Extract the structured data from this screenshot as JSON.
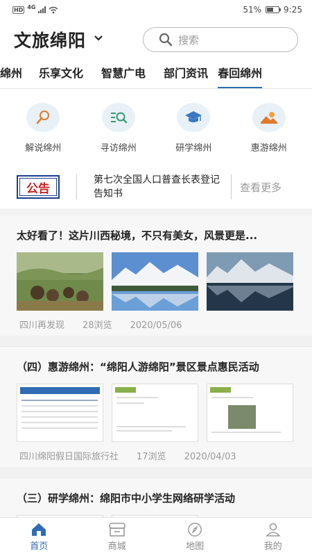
{
  "status_bar": {
    "network": "HD",
    "signal": "4G",
    "battery": "51%",
    "time": "9:25"
  },
  "header": {
    "title": "文旅绵阳",
    "search_placeholder": "搜索"
  },
  "tabs": [
    "绵州",
    "乐享文化",
    "智慧广电",
    "部门资讯",
    "春回绵州"
  ],
  "active_tab": "春回绵州",
  "quick_links": [
    {
      "label": "解说绵州",
      "icon": "microphone-icon"
    },
    {
      "label": "寻访绵州",
      "icon": "search-list-icon"
    },
    {
      "label": "研学绵州",
      "icon": "graduation-cap-icon"
    },
    {
      "label": "惠游绵州",
      "icon": "landscape-icon"
    }
  ],
  "notice": {
    "badge": "公告",
    "text": "第七次全国人口普查长表登记告知书",
    "more": "查看更多"
  },
  "articles": [
    {
      "title": "太好看了！这片川西秘境，不只有美女，风景更是...",
      "source": "四川再发现",
      "views": "28浏览",
      "date": "2020/05/06"
    },
    {
      "title": "（四）惠游绵州：“绵阳人游绵阳”景区景点惠民活动",
      "source": "四川绵阳假日国际旅行社",
      "views": "17浏览",
      "date": "2020/04/03"
    },
    {
      "title": "（三）研学绵州：绵阳市中小学生网络研学活动"
    }
  ],
  "bottom_nav": [
    {
      "label": "首页",
      "icon": "home-icon"
    },
    {
      "label": "商城",
      "icon": "store-icon"
    },
    {
      "label": "地图",
      "icon": "compass-icon"
    },
    {
      "label": "我的",
      "icon": "user-icon"
    }
  ],
  "colors": {
    "accent": "#2f6cb3",
    "notice_red": "#cc2020",
    "notice_blue": "#1a3d8f"
  }
}
